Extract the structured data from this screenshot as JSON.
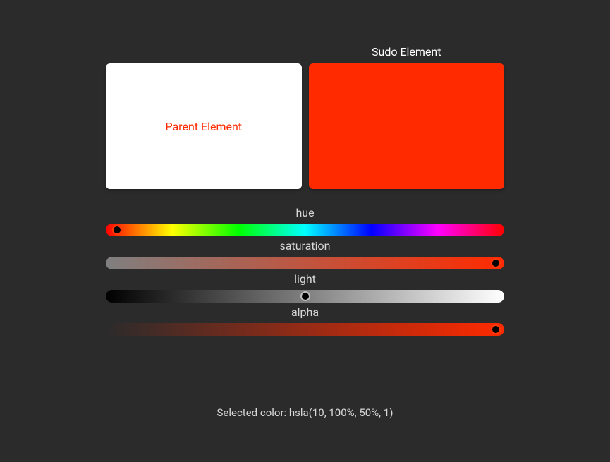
{
  "panels": {
    "parent": {
      "label": "Parent Element",
      "bg": "#ffffff",
      "fg": "hsl(10,100%,50%)"
    },
    "sudo": {
      "title": "Sudo Element",
      "bg": "hsla(10,100%,50%,1)"
    }
  },
  "sliders": {
    "hue": {
      "label": "hue",
      "value": 10,
      "min": 0,
      "max": 360,
      "percent": 2.78
    },
    "saturation": {
      "label": "saturation",
      "value": 100,
      "min": 0,
      "max": 100,
      "percent": 100,
      "gradient_from": "hsl(10,0%,50%)",
      "gradient_to": "hsl(10,100%,50%)"
    },
    "light": {
      "label": "light",
      "value": 50,
      "min": 0,
      "max": 100,
      "percent": 50
    },
    "alpha": {
      "label": "alpha",
      "value": 1,
      "min": 0,
      "max": 1,
      "percent": 100,
      "gradient_from": "hsla(10,100%,50%,0)",
      "gradient_to": "hsla(10,100%,50%,1)"
    }
  },
  "selected": {
    "prefix": "Selected color: ",
    "value": "hsla(10, 100%, 50%, 1)"
  }
}
